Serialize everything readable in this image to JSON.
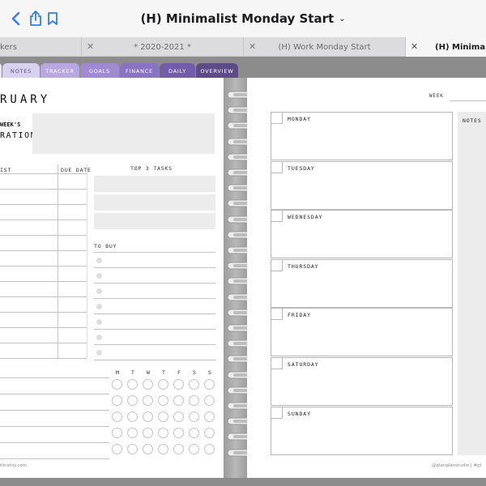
{
  "toolbar": {
    "title": "(H) Minimalist  Monday Start",
    "icons": [
      "chevron-left-icon",
      "bookmark-icon",
      "share-icon",
      "chevron-down-icon"
    ]
  },
  "tabs": [
    {
      "label": "kers",
      "active": false
    },
    {
      "label": "* 2020-2021 *",
      "active": false
    },
    {
      "label": "(H) Work Monday Start",
      "active": false
    },
    {
      "label": "(H) Minimalist",
      "active": true
    }
  ],
  "section_tabs": [
    {
      "label": "NOTES",
      "color": "#d9d1f0",
      "text_color": "#5b4e85"
    },
    {
      "label": "TRACKER",
      "color": "#b9a8e0",
      "text_color": "#ffffff"
    },
    {
      "label": "GOALS",
      "color": "#a08bd3",
      "text_color": "#ffffff"
    },
    {
      "label": "FINANCE",
      "color": "#8a73c3",
      "text_color": "#ffffff"
    },
    {
      "label": "DAILY",
      "color": "#735ca9",
      "text_color": "#ffffff"
    },
    {
      "label": "OVERVIEW",
      "color": "#5c4b86",
      "text_color": "#ffffff"
    }
  ],
  "left_page": {
    "month": "RUARY",
    "inspiration_line1": "WEEK'S",
    "inspiration_line2": "RATION",
    "list_header": "IST",
    "due_header": "DUE DATE",
    "top3_header": "TOP 3 TASKS",
    "to_buy_header": "TO BUY",
    "weekdays": [
      "M",
      "T",
      "W",
      "T",
      "F",
      "S",
      "S"
    ],
    "footer": "tio.etsy.com"
  },
  "right_page": {
    "week_label": "WEEK",
    "notes_label": "NOTES",
    "days": [
      "MONDAY",
      "TUESDAY",
      "WEDNESDAY",
      "THURSDAY",
      "FRIDAY",
      "SATURDAY",
      "SUNDAY"
    ],
    "footer": "@planplanstudio | #pl"
  },
  "colors": {
    "accent": "#7b65b3",
    "toolbar_icon": "#2f7ff0",
    "stage_bg": "#8c8c8c"
  }
}
